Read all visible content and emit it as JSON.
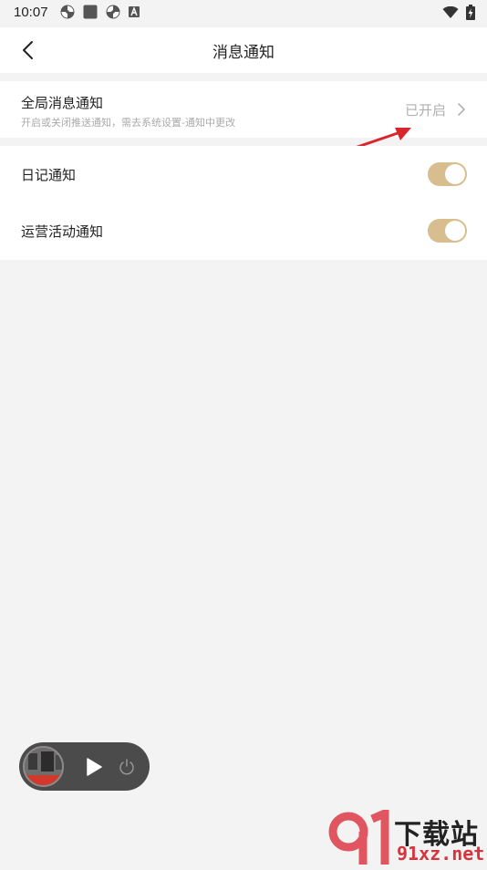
{
  "status_bar": {
    "time": "10:07",
    "icons": [
      "pinwheel-icon",
      "square-icon",
      "pinwheel-icon",
      "a-box-icon"
    ],
    "system_icons": [
      "wifi-icon",
      "battery-charging-icon"
    ]
  },
  "header": {
    "title": "消息通知",
    "back_icon": "chevron-left-icon"
  },
  "global_notification": {
    "title": "全局消息通知",
    "subtitle": "开启或关闭推送通知，需去系统设置-通知中更改",
    "status": "已开启",
    "chevron_icon": "chevron-right-icon"
  },
  "settings": [
    {
      "label": "日记通知",
      "enabled": true
    },
    {
      "label": "运营活动通知",
      "enabled": true
    }
  ],
  "floating_player": {
    "play_icon": "play-icon",
    "power_icon": "power-icon"
  },
  "watermark": {
    "brand_cn": "下载站",
    "brand_en": "91xz.net"
  },
  "colors": {
    "background": "#f3f3f3",
    "card": "#ffffff",
    "toggle_on": "#d8bd8f",
    "muted_text": "#b0b0b0",
    "annotation_arrow": "#d9262c",
    "watermark_red": "#d9333b"
  }
}
